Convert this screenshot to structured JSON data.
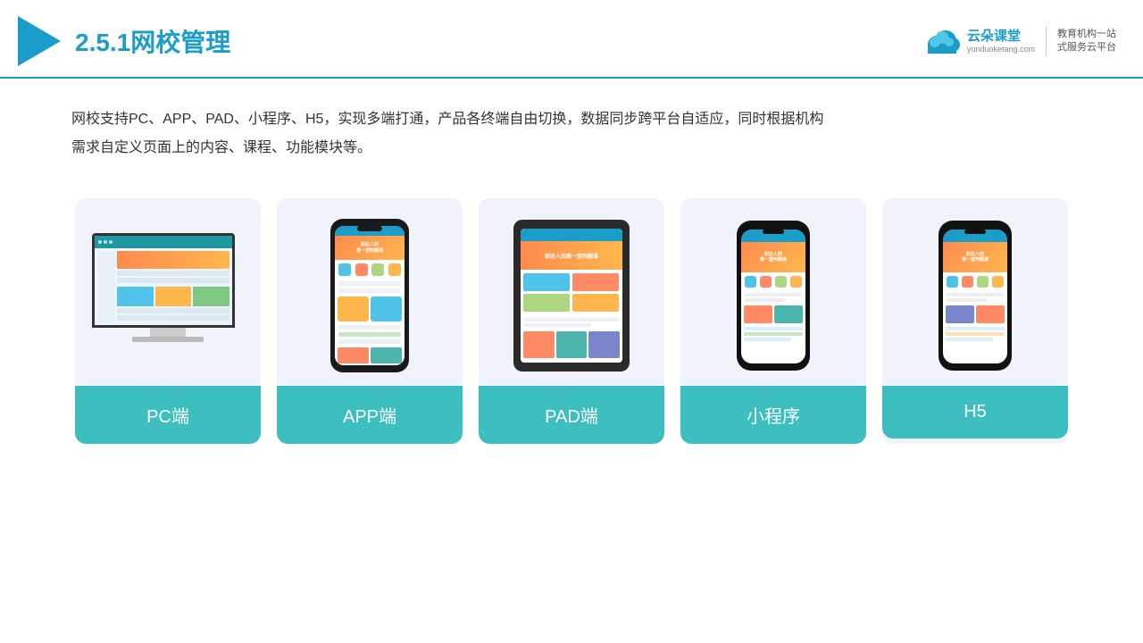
{
  "header": {
    "section": "2.5.1",
    "title_prefix": "2.5.1",
    "title": "网校管理",
    "logo": {
      "name": "云朵课堂",
      "url": "yunduoketang.com",
      "slogan_line1": "教育机构一站",
      "slogan_line2": "式服务云平台"
    }
  },
  "description": {
    "text": "网校支持PC、APP、PAD、小程序、H5，实现多端打通，产品各终端自由切换，数据同步跨平台自适应，同时根据机构",
    "text2": "需求自定义页面上的内容、课程、功能模块等。"
  },
  "cards": [
    {
      "id": "pc",
      "label": "PC端"
    },
    {
      "id": "app",
      "label": "APP端"
    },
    {
      "id": "pad",
      "label": "PAD端"
    },
    {
      "id": "miniprogram",
      "label": "小程序"
    },
    {
      "id": "h5",
      "label": "H5"
    }
  ],
  "colors": {
    "accent": "#1a9ec9",
    "card_bg": "#eef2fa",
    "card_label_bg": "#3dbfbf",
    "header_border": "#1a9ec9"
  }
}
